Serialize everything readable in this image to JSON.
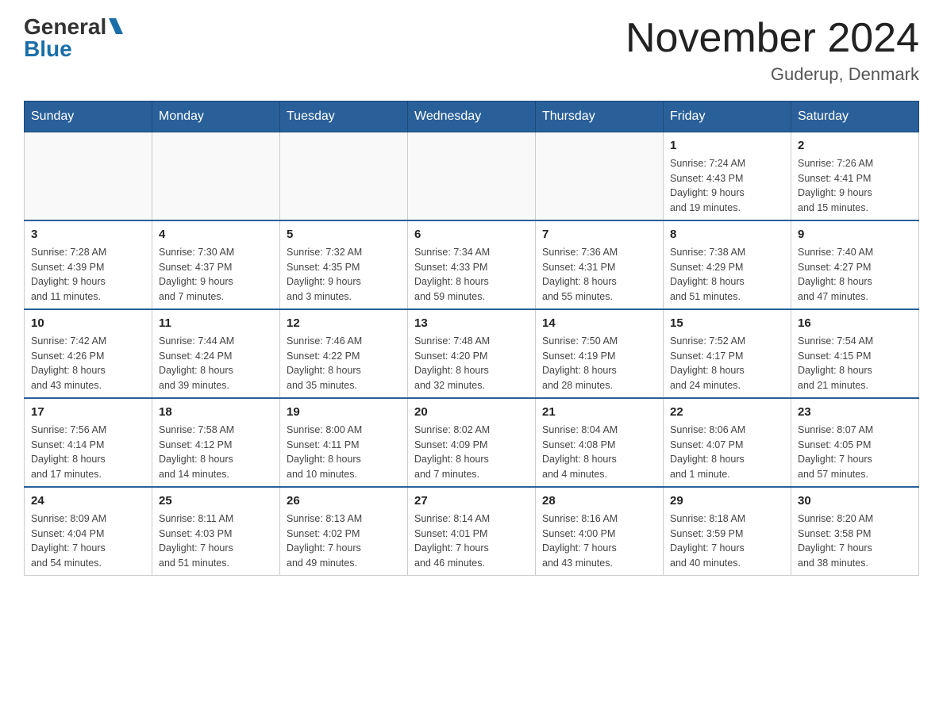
{
  "logo": {
    "general": "General",
    "blue": "Blue"
  },
  "title": "November 2024",
  "subtitle": "Guderup, Denmark",
  "days_header": [
    "Sunday",
    "Monday",
    "Tuesday",
    "Wednesday",
    "Thursday",
    "Friday",
    "Saturday"
  ],
  "weeks": [
    [
      {
        "day": "",
        "info": ""
      },
      {
        "day": "",
        "info": ""
      },
      {
        "day": "",
        "info": ""
      },
      {
        "day": "",
        "info": ""
      },
      {
        "day": "",
        "info": ""
      },
      {
        "day": "1",
        "info": "Sunrise: 7:24 AM\nSunset: 4:43 PM\nDaylight: 9 hours\nand 19 minutes."
      },
      {
        "day": "2",
        "info": "Sunrise: 7:26 AM\nSunset: 4:41 PM\nDaylight: 9 hours\nand 15 minutes."
      }
    ],
    [
      {
        "day": "3",
        "info": "Sunrise: 7:28 AM\nSunset: 4:39 PM\nDaylight: 9 hours\nand 11 minutes."
      },
      {
        "day": "4",
        "info": "Sunrise: 7:30 AM\nSunset: 4:37 PM\nDaylight: 9 hours\nand 7 minutes."
      },
      {
        "day": "5",
        "info": "Sunrise: 7:32 AM\nSunset: 4:35 PM\nDaylight: 9 hours\nand 3 minutes."
      },
      {
        "day": "6",
        "info": "Sunrise: 7:34 AM\nSunset: 4:33 PM\nDaylight: 8 hours\nand 59 minutes."
      },
      {
        "day": "7",
        "info": "Sunrise: 7:36 AM\nSunset: 4:31 PM\nDaylight: 8 hours\nand 55 minutes."
      },
      {
        "day": "8",
        "info": "Sunrise: 7:38 AM\nSunset: 4:29 PM\nDaylight: 8 hours\nand 51 minutes."
      },
      {
        "day": "9",
        "info": "Sunrise: 7:40 AM\nSunset: 4:27 PM\nDaylight: 8 hours\nand 47 minutes."
      }
    ],
    [
      {
        "day": "10",
        "info": "Sunrise: 7:42 AM\nSunset: 4:26 PM\nDaylight: 8 hours\nand 43 minutes."
      },
      {
        "day": "11",
        "info": "Sunrise: 7:44 AM\nSunset: 4:24 PM\nDaylight: 8 hours\nand 39 minutes."
      },
      {
        "day": "12",
        "info": "Sunrise: 7:46 AM\nSunset: 4:22 PM\nDaylight: 8 hours\nand 35 minutes."
      },
      {
        "day": "13",
        "info": "Sunrise: 7:48 AM\nSunset: 4:20 PM\nDaylight: 8 hours\nand 32 minutes."
      },
      {
        "day": "14",
        "info": "Sunrise: 7:50 AM\nSunset: 4:19 PM\nDaylight: 8 hours\nand 28 minutes."
      },
      {
        "day": "15",
        "info": "Sunrise: 7:52 AM\nSunset: 4:17 PM\nDaylight: 8 hours\nand 24 minutes."
      },
      {
        "day": "16",
        "info": "Sunrise: 7:54 AM\nSunset: 4:15 PM\nDaylight: 8 hours\nand 21 minutes."
      }
    ],
    [
      {
        "day": "17",
        "info": "Sunrise: 7:56 AM\nSunset: 4:14 PM\nDaylight: 8 hours\nand 17 minutes."
      },
      {
        "day": "18",
        "info": "Sunrise: 7:58 AM\nSunset: 4:12 PM\nDaylight: 8 hours\nand 14 minutes."
      },
      {
        "day": "19",
        "info": "Sunrise: 8:00 AM\nSunset: 4:11 PM\nDaylight: 8 hours\nand 10 minutes."
      },
      {
        "day": "20",
        "info": "Sunrise: 8:02 AM\nSunset: 4:09 PM\nDaylight: 8 hours\nand 7 minutes."
      },
      {
        "day": "21",
        "info": "Sunrise: 8:04 AM\nSunset: 4:08 PM\nDaylight: 8 hours\nand 4 minutes."
      },
      {
        "day": "22",
        "info": "Sunrise: 8:06 AM\nSunset: 4:07 PM\nDaylight: 8 hours\nand 1 minute."
      },
      {
        "day": "23",
        "info": "Sunrise: 8:07 AM\nSunset: 4:05 PM\nDaylight: 7 hours\nand 57 minutes."
      }
    ],
    [
      {
        "day": "24",
        "info": "Sunrise: 8:09 AM\nSunset: 4:04 PM\nDaylight: 7 hours\nand 54 minutes."
      },
      {
        "day": "25",
        "info": "Sunrise: 8:11 AM\nSunset: 4:03 PM\nDaylight: 7 hours\nand 51 minutes."
      },
      {
        "day": "26",
        "info": "Sunrise: 8:13 AM\nSunset: 4:02 PM\nDaylight: 7 hours\nand 49 minutes."
      },
      {
        "day": "27",
        "info": "Sunrise: 8:14 AM\nSunset: 4:01 PM\nDaylight: 7 hours\nand 46 minutes."
      },
      {
        "day": "28",
        "info": "Sunrise: 8:16 AM\nSunset: 4:00 PM\nDaylight: 7 hours\nand 43 minutes."
      },
      {
        "day": "29",
        "info": "Sunrise: 8:18 AM\nSunset: 3:59 PM\nDaylight: 7 hours\nand 40 minutes."
      },
      {
        "day": "30",
        "info": "Sunrise: 8:20 AM\nSunset: 3:58 PM\nDaylight: 7 hours\nand 38 minutes."
      }
    ]
  ]
}
